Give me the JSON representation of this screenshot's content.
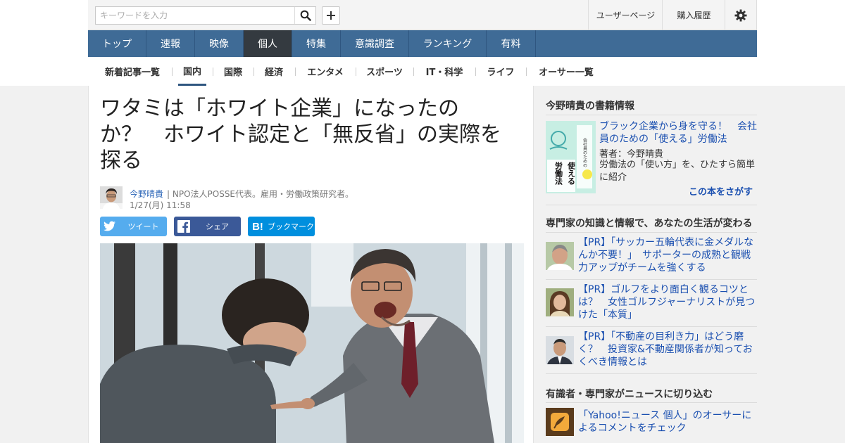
{
  "search": {
    "placeholder": "キーワードを入力"
  },
  "header_links": {
    "user_page": "ユーザーページ",
    "purchase_history": "購入履歴"
  },
  "main_nav": [
    "トップ",
    "速報",
    "映像",
    "個人",
    "特集",
    "意識調査",
    "ランキング",
    "有料"
  ],
  "main_nav_active": "個人",
  "sub_nav": [
    "新着記事一覧",
    "国内",
    "国際",
    "経済",
    "エンタメ",
    "スポーツ",
    "IT・科学",
    "ライフ",
    "オーサー一覧"
  ],
  "sub_nav_active": "国内",
  "article": {
    "title_lines": [
      "ワタミは「ホワイト企業」になったの",
      "か？　ホワイト認定と「無反省」の実際を",
      "探る"
    ],
    "author_name": "今野晴貴",
    "author_desc": "| NPO法人POSSE代表。雇用・労働政策研究者。",
    "date": "1/27(月) 11:58",
    "share": {
      "tweet": "ツイート",
      "facebook": "シェア",
      "hatena": "ブックマーク"
    }
  },
  "sidebar": {
    "book_section": {
      "heading": "今野晴貴の書籍情報",
      "book_title": "ブラック企業から身を守る！　会社員のための「使える」労働法",
      "cover_text": {
        "small": "会社員のための",
        "big1": "使える",
        "big2": "労働法"
      },
      "author_line": "著者：今野晴貴",
      "description": "労働法の「使い方」を、ひたすら簡単に紹介",
      "find_link": "この本をさがす"
    },
    "pr_section": {
      "heading": "専門家の知識と情報で、あなたの生活が変わる",
      "items": [
        "【PR】「サッカー五輪代表に金メダルなんか不要！」　サポーターの成熟と観戦力アップがチームを強くする",
        "【PR】ゴルフをより面白く観るコツとは？　女性ゴルフジャーナリストが見つけた「本質」",
        "【PR】「不動産の目利き力」はどう磨く？　投資家&不動産関係者が知っておくべき情報とは"
      ]
    },
    "comment_section": {
      "heading": "有識者・専門家がニュースに切り込む",
      "link_text": "「Yahoo!ニュース 個人」のオーサーによるコメントをチェック"
    }
  },
  "colors": {
    "nav_blue": "#3f6b96",
    "nav_active": "#343a40",
    "twitter": "#55acee",
    "facebook": "#3b5998",
    "hatena": "#008fde",
    "link": "#1a4fb0"
  }
}
